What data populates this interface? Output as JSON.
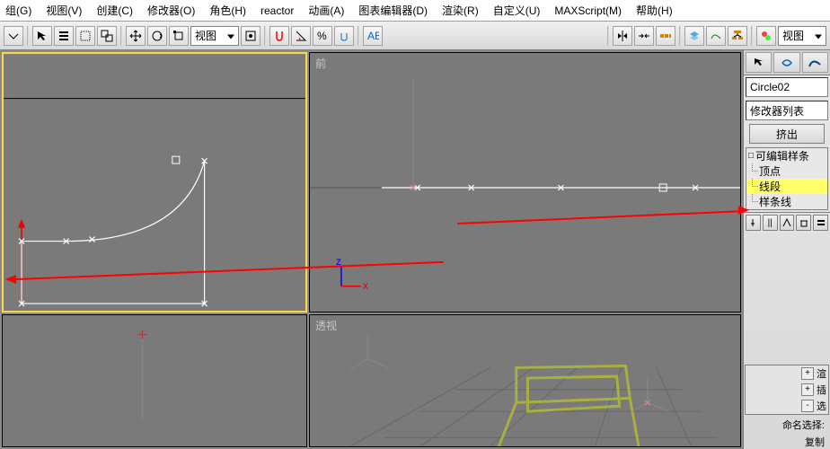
{
  "menu": {
    "items": [
      "组(G)",
      "视图(V)",
      "创建(C)",
      "修改器(O)",
      "角色(H)",
      "reactor",
      "动画(A)",
      "图表编辑器(D)",
      "渲染(R)",
      "自定义(U)",
      "MAXScript(M)",
      "帮助(H)"
    ]
  },
  "toolbar": {
    "view_select": "视图",
    "view_select_right": "视图"
  },
  "viewports": {
    "top_left_label": "",
    "top_right_label": "前",
    "bottom_left_label": "",
    "bottom_right_label": "透视"
  },
  "panel": {
    "object_name": "Circle02",
    "modifier_list": "修改器列表",
    "extrude_button": "挤出",
    "stack": {
      "root": "可编辑样条",
      "sub": [
        "顶点",
        "线段",
        "样条线"
      ],
      "selected_index": 1
    },
    "rollouts": [
      "渲",
      "插",
      "选"
    ],
    "label_name_select": "命名选择:",
    "label_copy": "复制"
  }
}
